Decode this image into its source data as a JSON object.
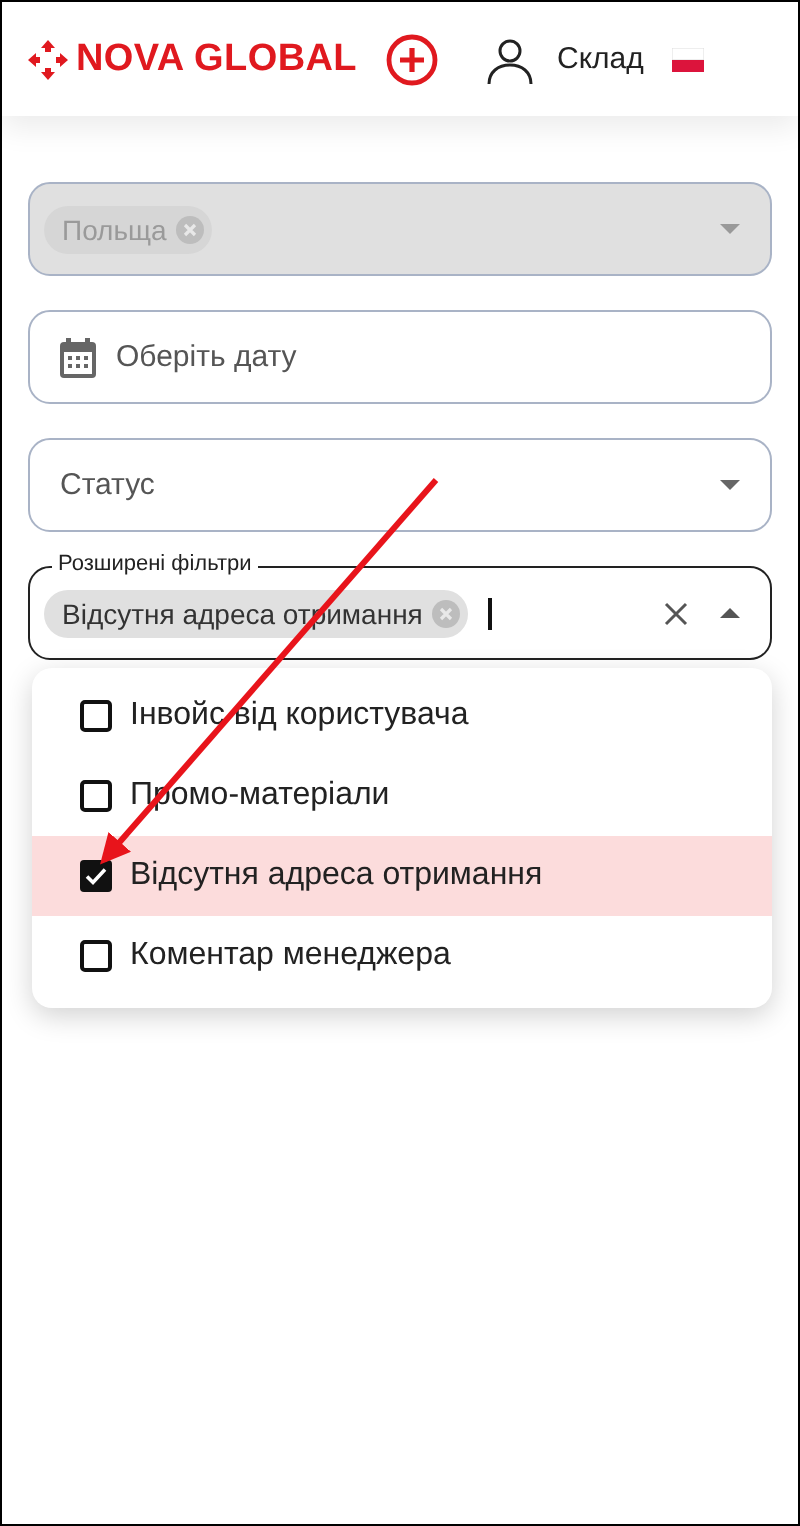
{
  "header": {
    "logo": "NOVA GLOBAL",
    "user_label": "Склад"
  },
  "filters": {
    "country": {
      "chips": [
        "Польща"
      ],
      "disabled": true
    },
    "date": {
      "placeholder": "Оберіть дату"
    },
    "status": {
      "placeholder": "Статус"
    },
    "advanced": {
      "label": "Розширені фільтри",
      "chips": [
        "Відсутня адреса отримання"
      ],
      "expanded": true
    }
  },
  "options": [
    {
      "label": "Інвойс від користувача",
      "checked": false,
      "selected": false
    },
    {
      "label": "Промо-матеріали",
      "checked": false,
      "selected": false
    },
    {
      "label": "Відсутня адреса отримання",
      "checked": true,
      "selected": true
    },
    {
      "label": "Коментар менеджера",
      "checked": false,
      "selected": false
    }
  ]
}
